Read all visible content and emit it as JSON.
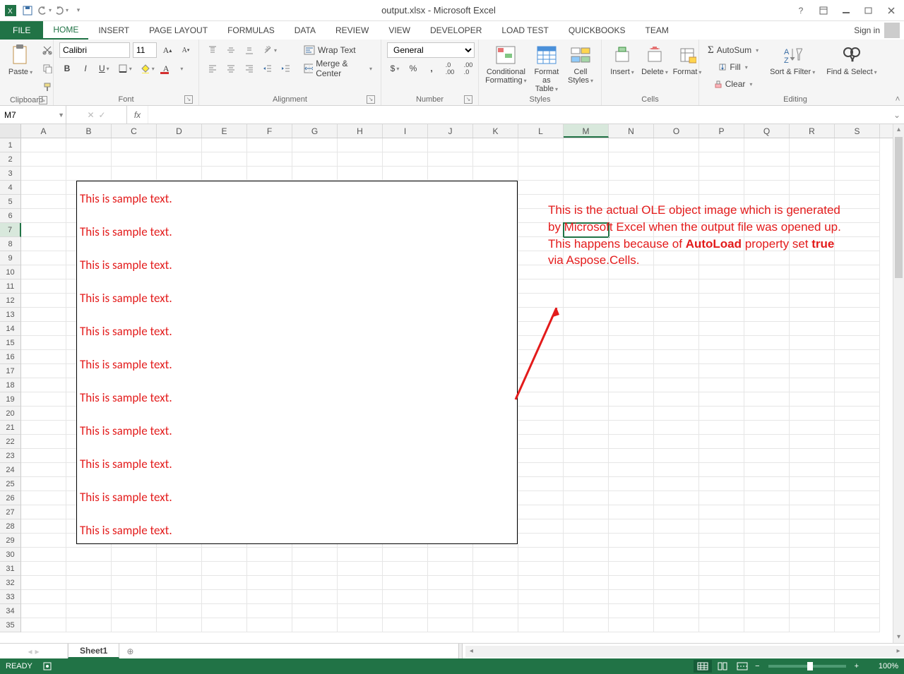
{
  "title": "output.xlsx - Microsoft Excel",
  "signin": "Sign in",
  "tabs": [
    "FILE",
    "HOME",
    "INSERT",
    "PAGE LAYOUT",
    "FORMULAS",
    "DATA",
    "REVIEW",
    "VIEW",
    "DEVELOPER",
    "LOAD TEST",
    "QuickBooks",
    "TEAM"
  ],
  "active_tab": "HOME",
  "ribbon": {
    "clipboard": {
      "paste": "Paste",
      "title": "Clipboard"
    },
    "font": {
      "name": "Calibri",
      "size": "11",
      "title": "Font"
    },
    "alignment": {
      "wrap": "Wrap Text",
      "merge": "Merge & Center",
      "title": "Alignment"
    },
    "number": {
      "format": "General",
      "title": "Number"
    },
    "styles": {
      "cond": "Conditional Formatting",
      "fmt_table": "Format as Table",
      "cell": "Cell Styles",
      "title": "Styles"
    },
    "cells": {
      "insert": "Insert",
      "delete": "Delete",
      "format": "Format",
      "title": "Cells"
    },
    "editing": {
      "autosum": "AutoSum",
      "fill": "Fill",
      "clear": "Clear",
      "sort": "Sort & Filter",
      "find": "Find & Select",
      "title": "Editing"
    }
  },
  "namebox": "M7",
  "formula": "",
  "columns": [
    "A",
    "B",
    "C",
    "D",
    "E",
    "F",
    "G",
    "H",
    "I",
    "J",
    "K",
    "L",
    "M",
    "N",
    "O",
    "P",
    "Q",
    "R",
    "S"
  ],
  "row_count": 35,
  "selected_cell": {
    "col": "M",
    "row": 7
  },
  "ole_lines": [
    "This is sample text.",
    "This is sample text.",
    "This is sample text.",
    "This is sample text.",
    "This is sample text.",
    "This is sample text.",
    "This is sample text.",
    "This is sample text.",
    "This is sample text.",
    "This is sample text.",
    "This is sample text."
  ],
  "annotation": {
    "pre": "This is the actual OLE object image which is generated by Microsoft Excel when the output file was opened up. This happens because of ",
    "b1": "AutoLoad",
    "mid": " property set ",
    "b2": "true",
    "post": " via Aspose.Cells."
  },
  "sheet_tab": "Sheet1",
  "status": {
    "ready": "READY",
    "zoom": "100%"
  }
}
